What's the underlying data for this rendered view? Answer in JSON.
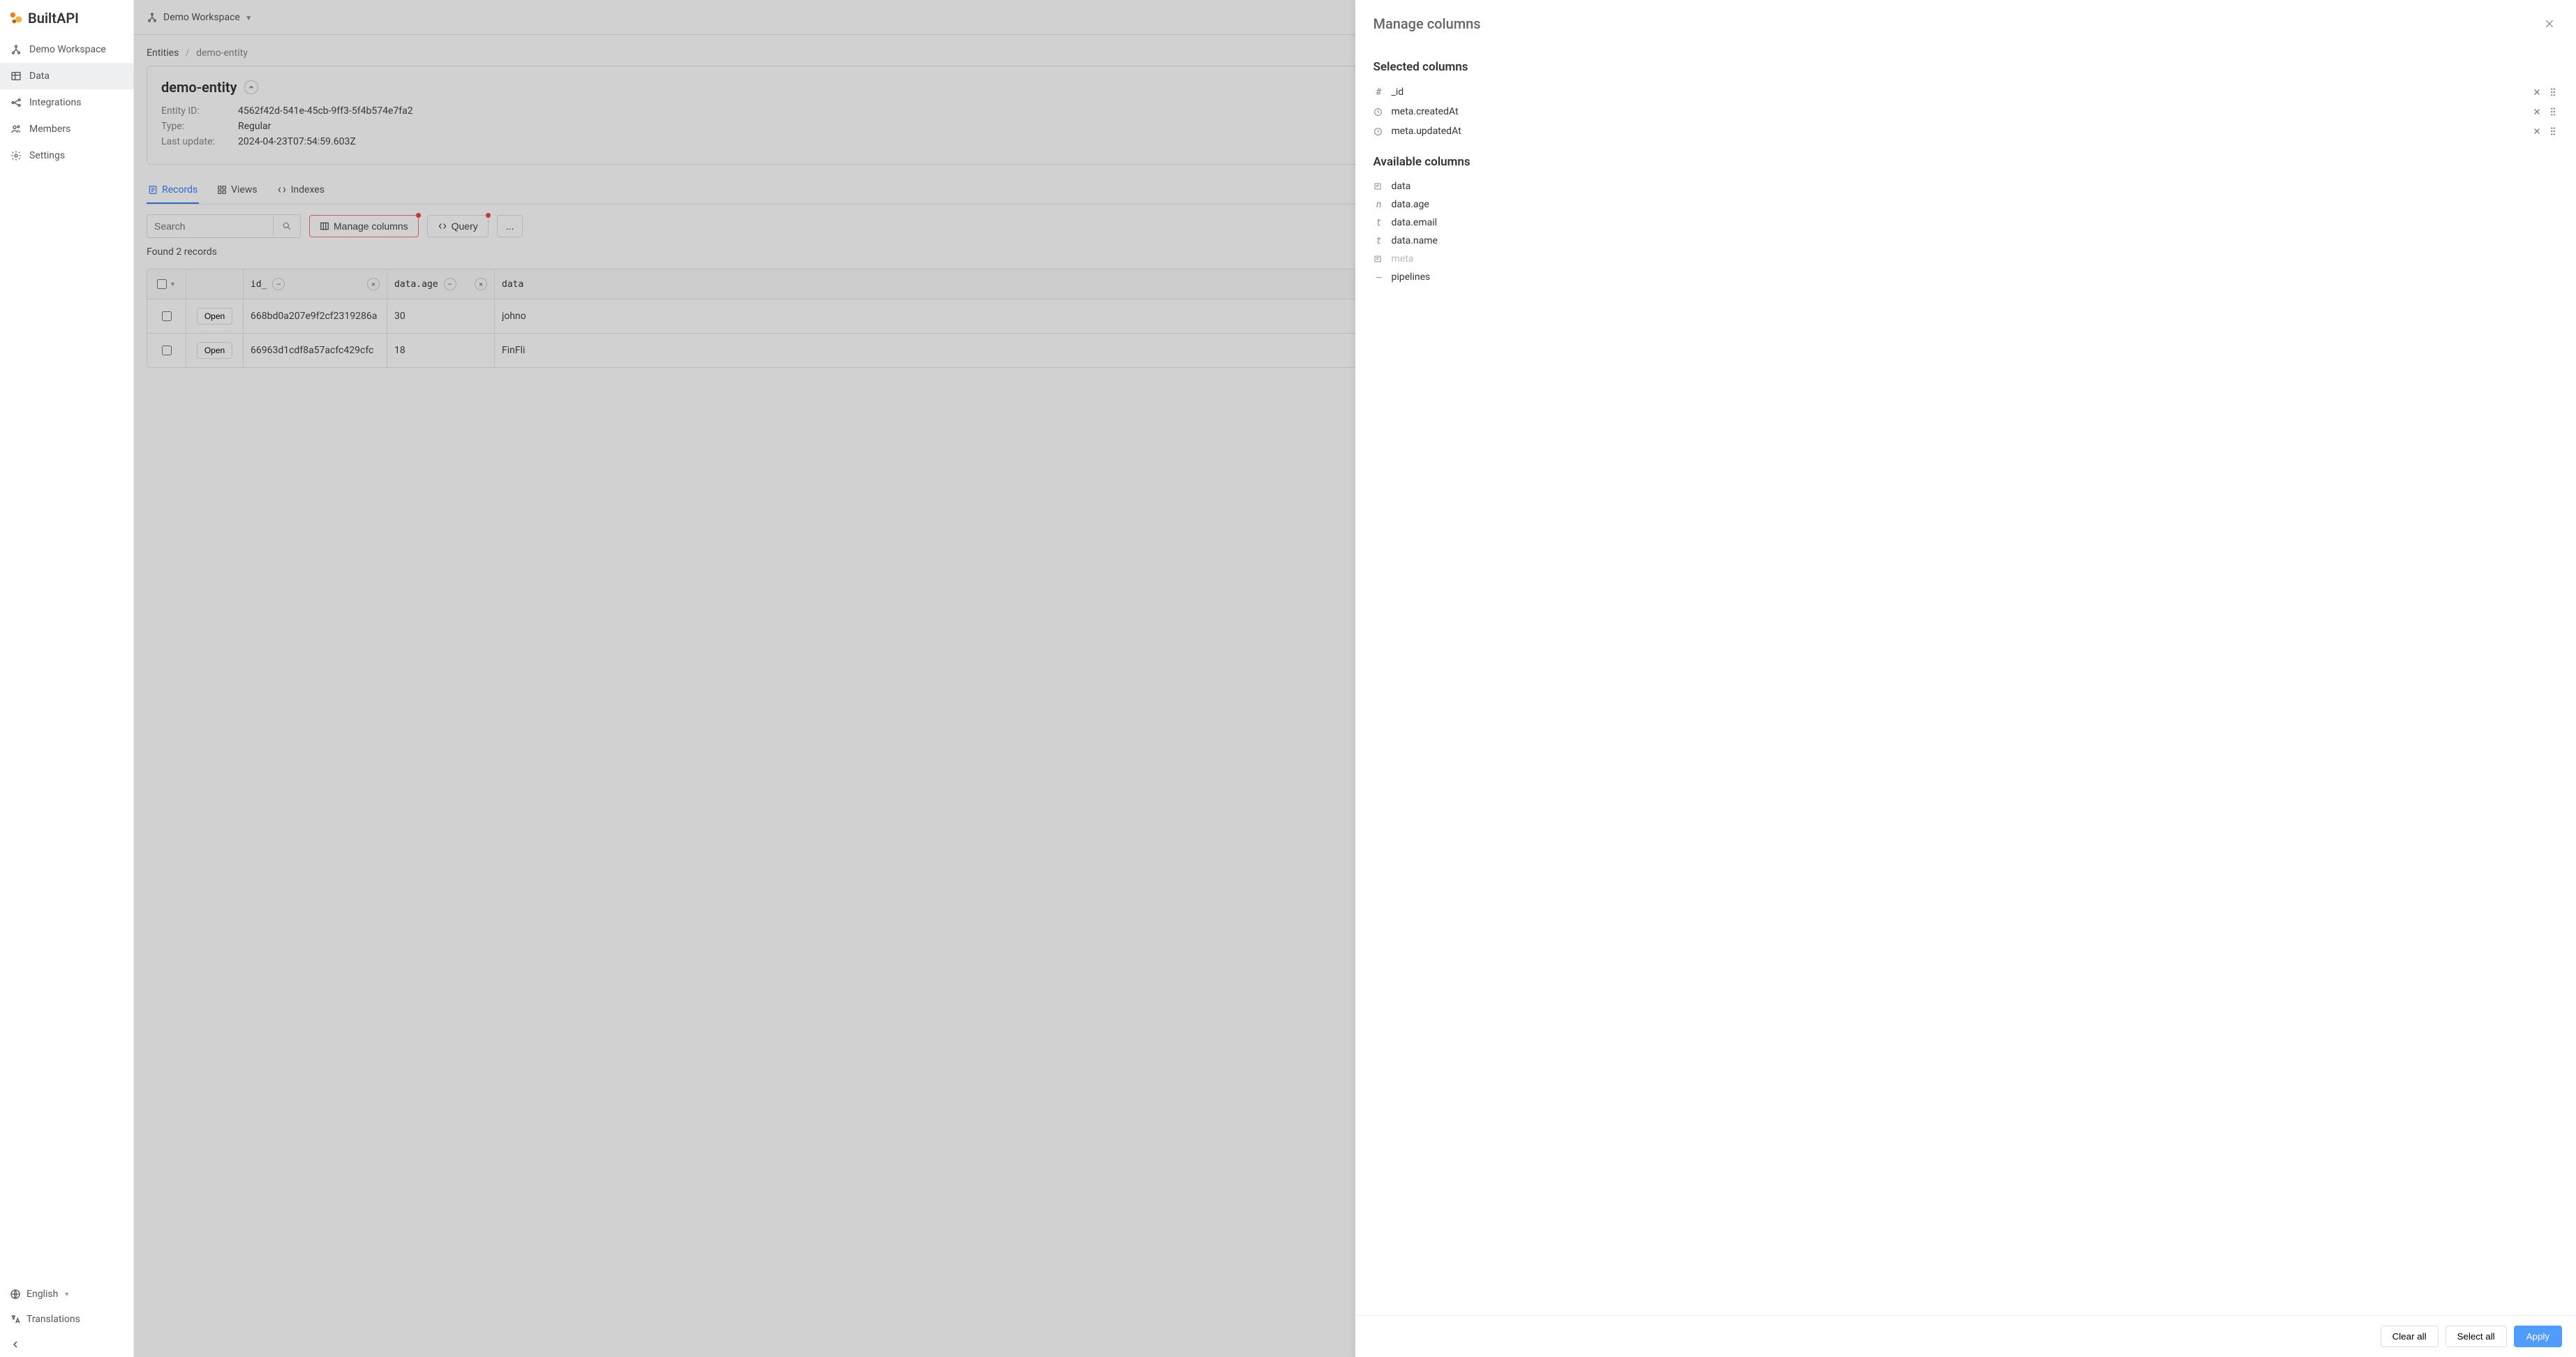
{
  "brand": {
    "name": "BuiltAPI"
  },
  "sidebar": {
    "workspace": "Demo Workspace",
    "items": [
      {
        "label": "Data",
        "icon": "table-icon",
        "active": true
      },
      {
        "label": "Integrations",
        "icon": "integrations-icon"
      },
      {
        "label": "Members",
        "icon": "members-icon"
      },
      {
        "label": "Settings",
        "icon": "settings-icon"
      }
    ],
    "language": "English",
    "translations": "Translations"
  },
  "topbar": {
    "workspace": "Demo Workspace"
  },
  "breadcrumb": {
    "root": "Entities",
    "leaf": "demo-entity"
  },
  "entity": {
    "name": "demo-entity",
    "fields": {
      "id_label": "Entity ID:",
      "id_value": "4562f42d-541e-45cb-9ff3-5f4b574e7fa2",
      "type_label": "Type:",
      "type_value": "Regular",
      "updated_label": "Last update:",
      "updated_value": "2024-04-23T07:54:59.603Z"
    }
  },
  "tabs": [
    {
      "label": "Records",
      "active": true
    },
    {
      "label": "Views"
    },
    {
      "label": "Indexes"
    }
  ],
  "toolbar": {
    "search_placeholder": "Search",
    "manage_columns": "Manage columns",
    "query": "Query",
    "more": "..."
  },
  "records": {
    "count_text": "Found 2 records",
    "columns": [
      {
        "key": "id_",
        "label": "id_"
      },
      {
        "key": "data.age",
        "label": "data.age"
      },
      {
        "key": "data.email",
        "label": "data"
      }
    ],
    "rows": [
      {
        "open": "Open",
        "id": "668bd0a207e9f2cf2319286a",
        "age": "30",
        "email": "johno"
      },
      {
        "open": "Open",
        "id": "66963d1cdf8a57acfc429cfc",
        "age": "18",
        "email": "FinFli"
      }
    ]
  },
  "drawer": {
    "title": "Manage columns",
    "selected_title": "Selected columns",
    "available_title": "Available columns",
    "selected": [
      {
        "type": "#",
        "name": "_id"
      },
      {
        "type": "clock",
        "name": "meta.createdAt"
      },
      {
        "type": "clock",
        "name": "meta.updatedAt"
      }
    ],
    "available": [
      {
        "type": "obj",
        "name": "data"
      },
      {
        "type": "n",
        "name": "data.age"
      },
      {
        "type": "t",
        "name": "data.email"
      },
      {
        "type": "t",
        "name": "data.name"
      },
      {
        "type": "obj",
        "name": "meta",
        "muted": true
      },
      {
        "type": "—",
        "name": "pipelines"
      }
    ],
    "footer": {
      "clear": "Clear all",
      "select": "Select all",
      "apply": "Apply"
    }
  }
}
